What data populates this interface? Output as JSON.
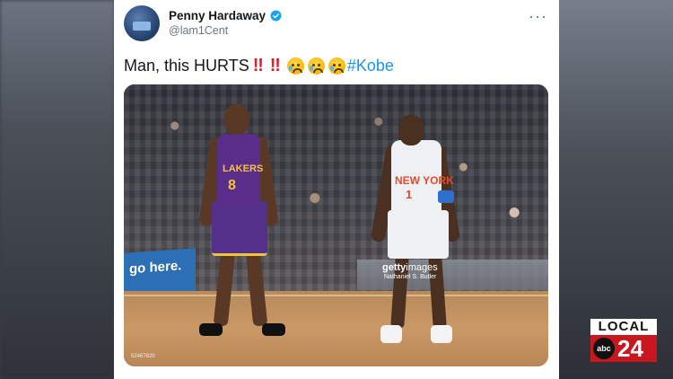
{
  "tweet": {
    "author_name": "Penny Hardaway",
    "handle": "@lam1Cent",
    "text": "Man, this HURTS",
    "bang1": "‼",
    "bang2": "‼",
    "hashtag": "#Kobe",
    "more_icon": "more-icon"
  },
  "photo": {
    "getty_brand_a": "getty",
    "getty_brand_b": "images",
    "credit": "Nathaniel S. Butler",
    "photo_id": "52467820",
    "banner_text": "go here.",
    "kobe_text": "LAKERS",
    "kobe_number": "8",
    "penny_text": "NEW YORK",
    "penny_number": "1"
  },
  "station": {
    "top": "LOCAL",
    "network": "abc",
    "number": "24"
  },
  "colors": {
    "verified": "#1da1f2",
    "hashtag": "#1b95e0",
    "bang": "#e0202a",
    "station_red": "#c8171e"
  }
}
